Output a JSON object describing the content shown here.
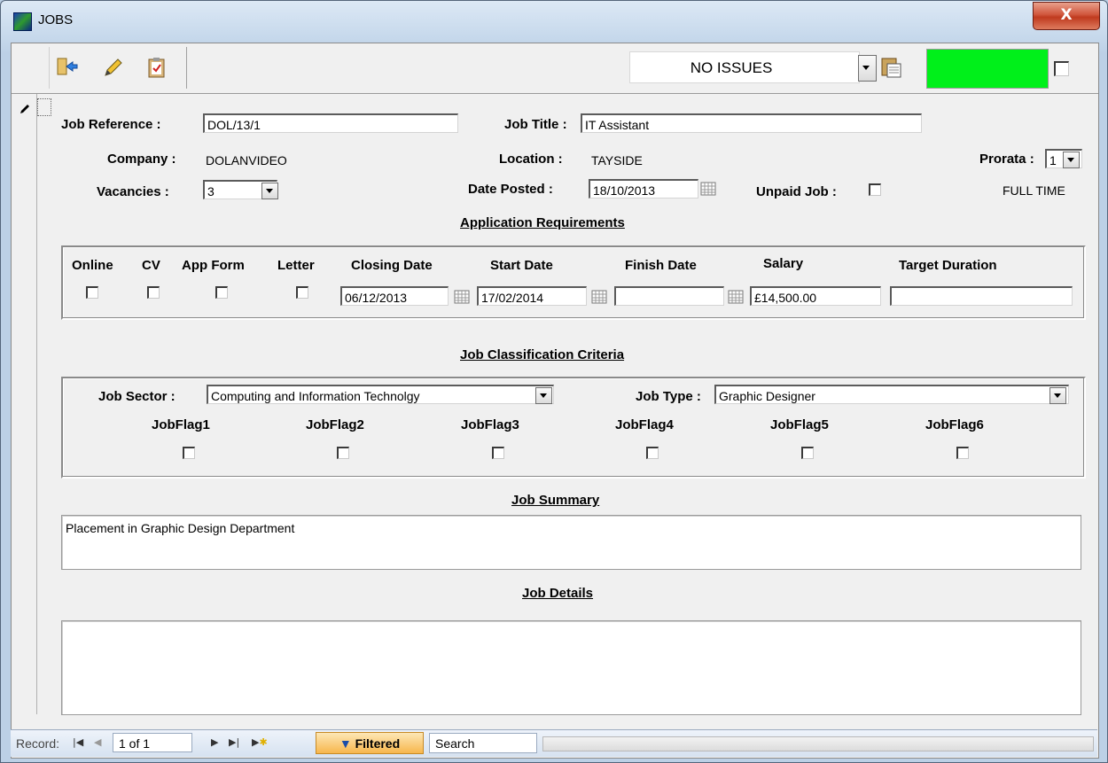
{
  "window": {
    "title": "JOBS",
    "close_label": "X"
  },
  "toolbar": {
    "issues_status": "NO ISSUES",
    "status_color": "#00f01a"
  },
  "job": {
    "reference_label": "Job Reference :",
    "reference": "DOL/13/1",
    "title_label": "Job Title :",
    "title": "IT Assistant",
    "company_label": "Company :",
    "company": "DOLANVIDEO",
    "location_label": "Location :",
    "location": "TAYSIDE",
    "prorata_label": "Prorata :",
    "prorata": "1",
    "vacancies_label": "Vacancies :",
    "vacancies": "3",
    "date_posted_label": "Date Posted :",
    "date_posted": "18/10/2013",
    "unpaid_label": "Unpaid Job :",
    "employment_type": "FULL TIME"
  },
  "application": {
    "section_title": "Application Requirements",
    "online_label": "Online",
    "cv_label": "CV",
    "app_form_label": "App Form",
    "letter_label": "Letter",
    "closing_label": "Closing Date",
    "closing": "06/12/2013",
    "start_label": "Start Date",
    "start": "17/02/2014",
    "finish_label": "Finish Date",
    "finish": "",
    "salary_label": "Salary",
    "salary": "£14,500.00",
    "target_label": "Target Duration",
    "target": ""
  },
  "classification": {
    "section_title": "Job Classification Criteria",
    "sector_label": "Job Sector :",
    "sector": "Computing and Information Technolgy",
    "type_label": "Job Type :",
    "type": "Graphic Designer",
    "flags": [
      "JobFlag1",
      "JobFlag2",
      "JobFlag3",
      "JobFlag4",
      "JobFlag5",
      "JobFlag6"
    ]
  },
  "summary": {
    "section_title": "Job Summary",
    "text": "Placement in Graphic Design Department"
  },
  "details": {
    "section_title": "Job Details",
    "text": ""
  },
  "nav": {
    "record_label": "Record:",
    "position": "1 of 1",
    "filter_label": "Filtered",
    "search_placeholder": "Search"
  }
}
